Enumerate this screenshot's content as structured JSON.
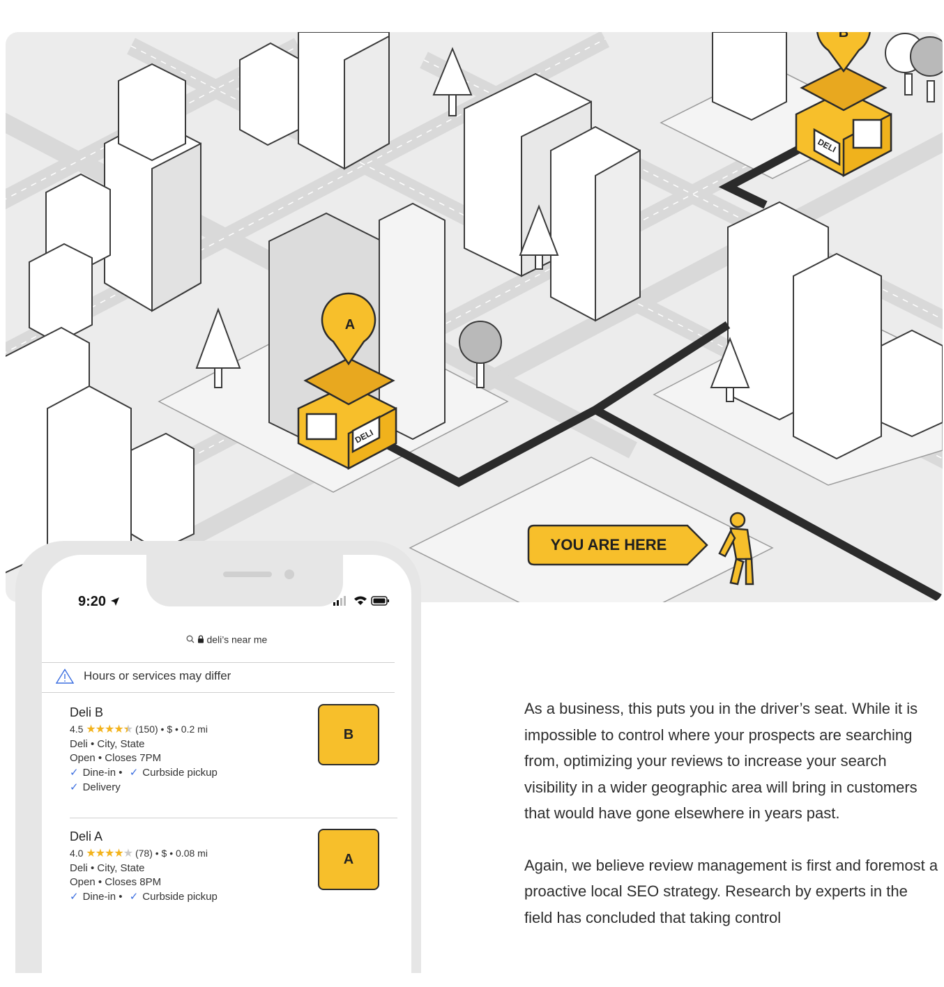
{
  "map": {
    "pin_a_label": "A",
    "pin_b_label": "B",
    "deli_sign": "DELI",
    "you_are_here": "YOU ARE HERE",
    "colors": {
      "accent": "#f7bf2b",
      "ink": "#2b2b2b",
      "ground": "#ececec"
    }
  },
  "phone": {
    "time": "9:20",
    "url": "deli’s near me",
    "notice": "Hours or services may differ",
    "listings": [
      {
        "name": "Deli B",
        "rating": "4.5",
        "reviews": "(150) • $ • 0.2 mi",
        "category": "Deli • City, State",
        "hours": "Open • Closes 7PM",
        "opt1": "Dine-in •",
        "opt2": "Curbside pickup",
        "opt3": "Delivery",
        "thumb": "B"
      },
      {
        "name": "Deli A",
        "rating": "4.0",
        "reviews": "(78) • $ • 0.08 mi",
        "category": "Deli • City, State",
        "hours": "Open • Closes 8PM",
        "opt1": "Dine-in •",
        "opt2": "Curbside pickup",
        "thumb": "A"
      }
    ]
  },
  "article": {
    "p1": "As a business, this puts you in the driver’s seat. While it is impossible to control where your prospects are searching from, optimizing your reviews to increase your search visibility in a wider geographic area will bring in customers that would have gone elsewhere in years past.",
    "p2": "Again, we believe review management is first and foremost a proactive local SEO strategy. Research by experts in the field has concluded that taking control"
  }
}
